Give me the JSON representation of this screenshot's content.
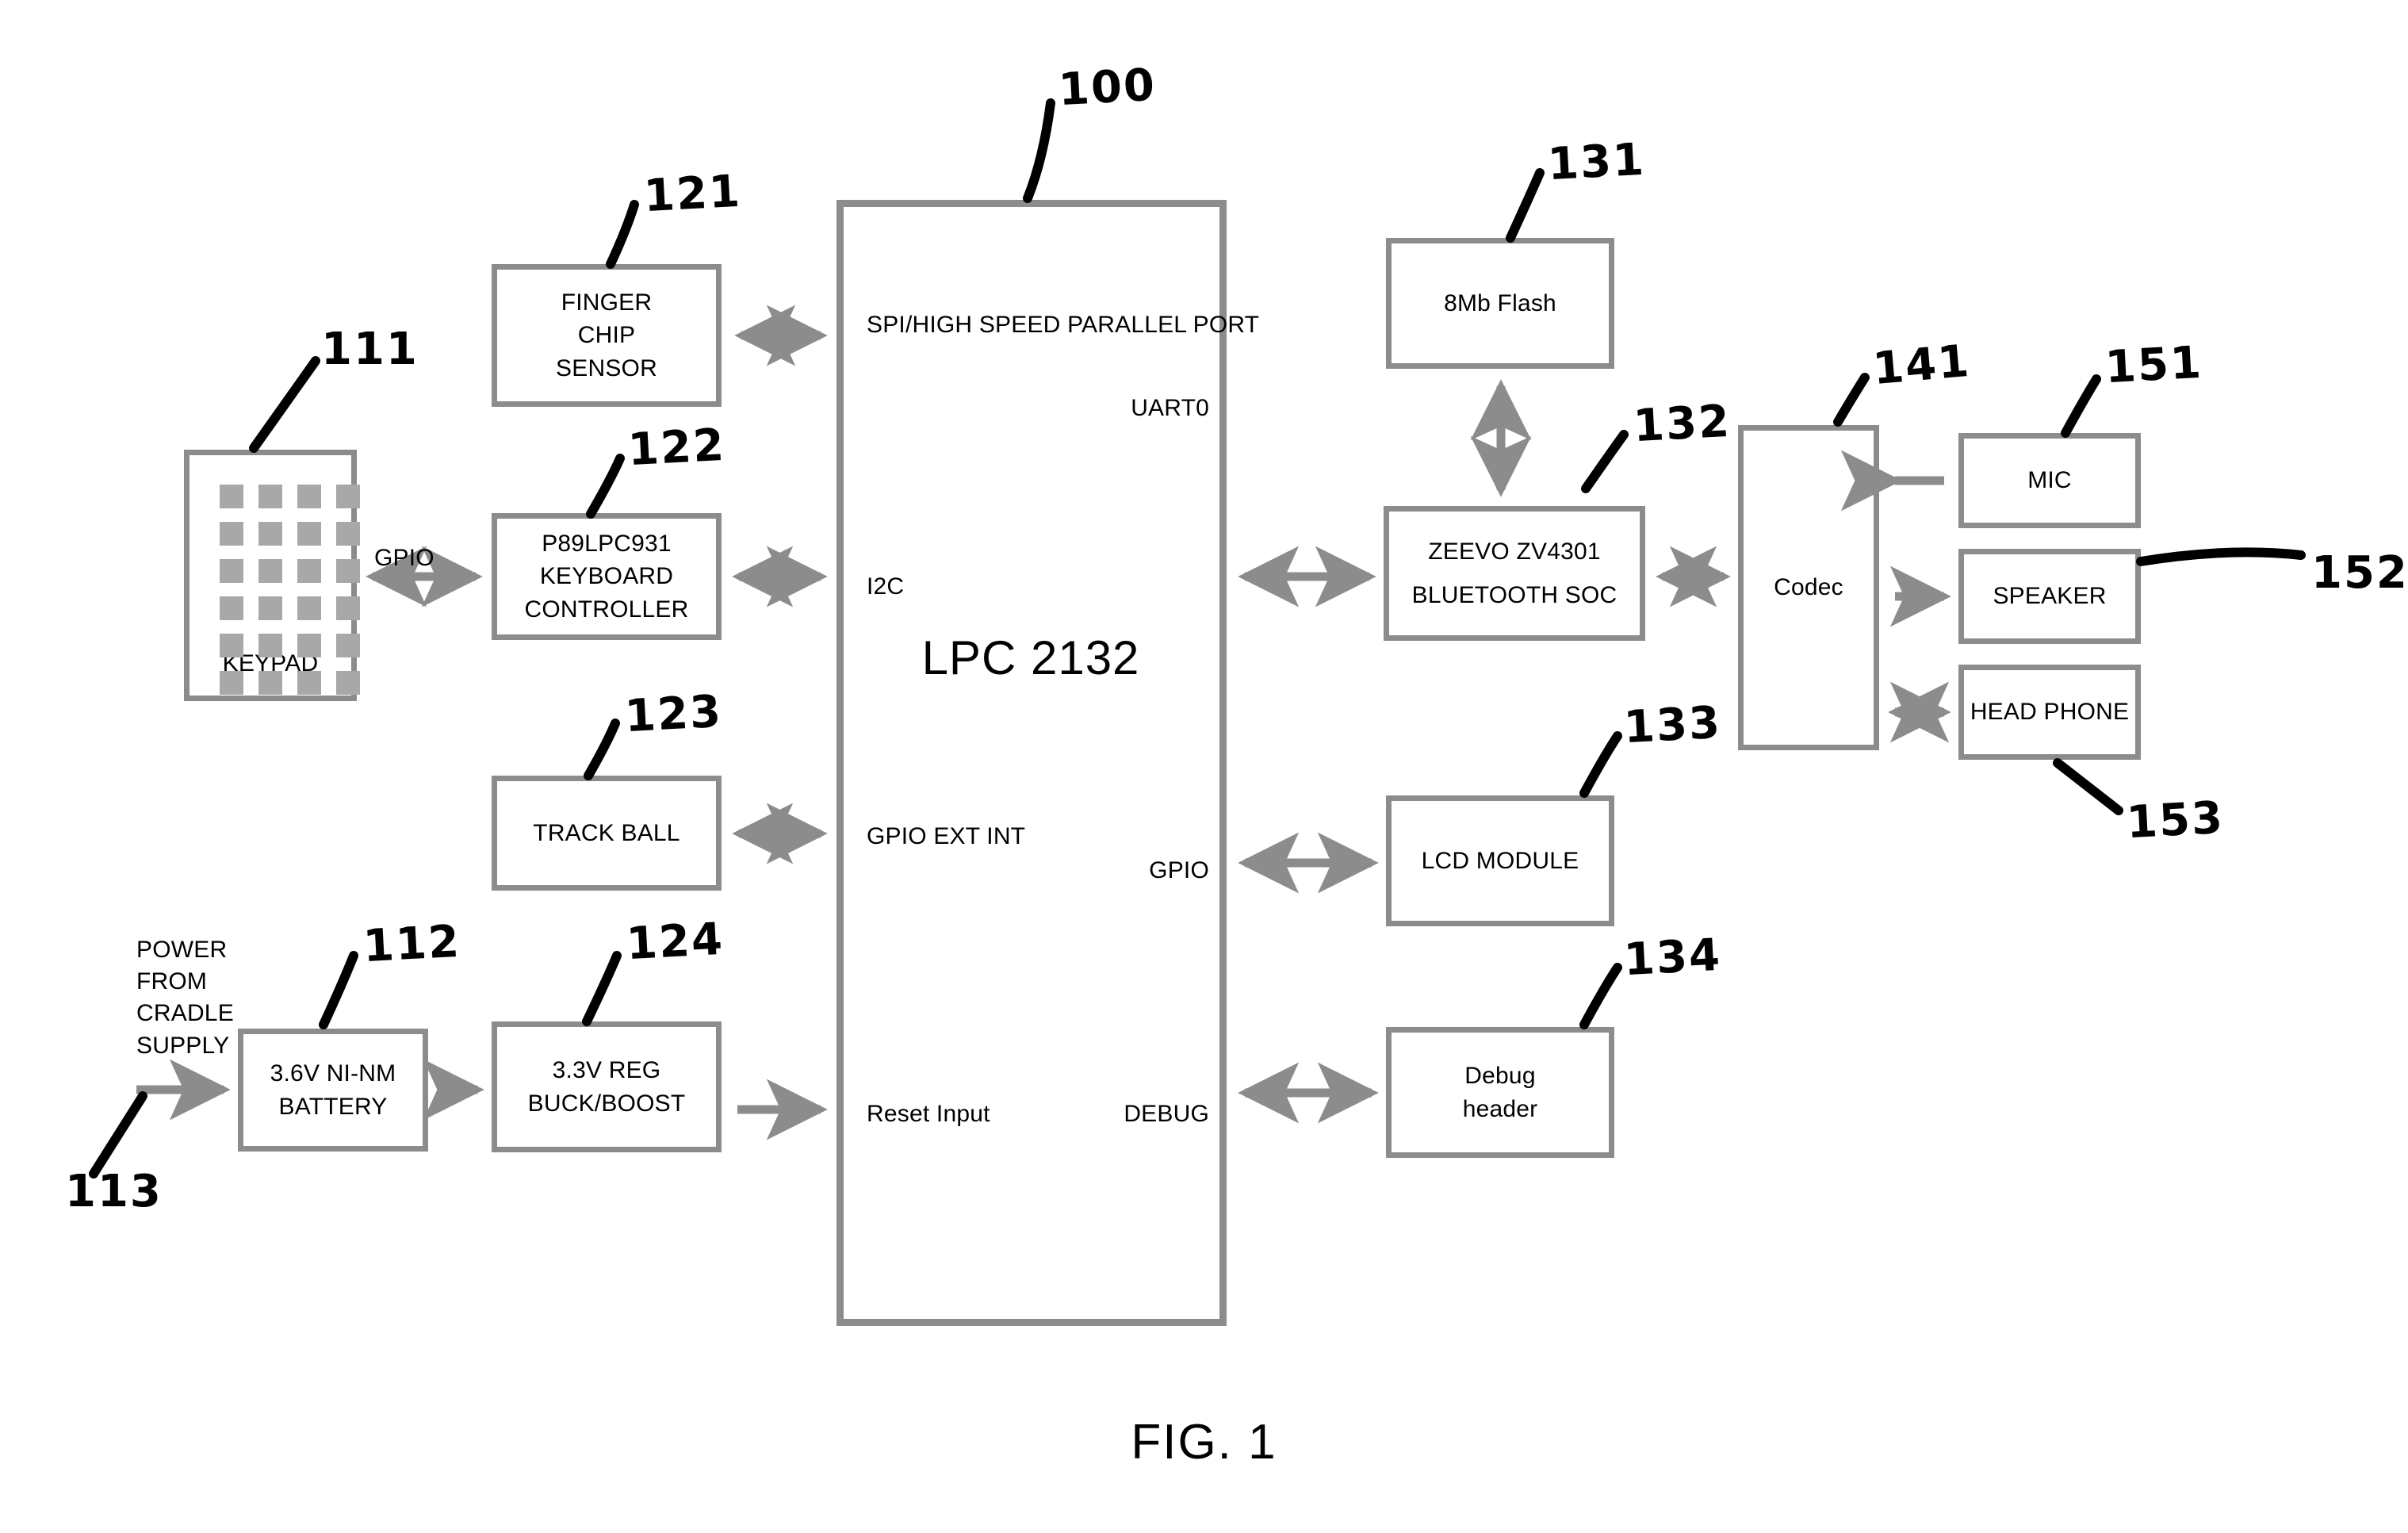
{
  "figure": {
    "caption": "FIG. 1",
    "mcu": {
      "title": "LPC 2132",
      "ref": "100",
      "ports": {
        "spi": "SPI/HIGH SPEED\nPARALLEL PORT",
        "uart0": "UART0",
        "i2c": "I2C",
        "gpio_ext_int": "GPIO\nEXT INT",
        "gpio_lcd": "GPIO",
        "reset": "Reset Input",
        "debug": "DEBUG"
      }
    },
    "blocks": {
      "finger_chip_sensor": {
        "lines": [
          "FINGER",
          "CHIP",
          "SENSOR"
        ],
        "ref": "121"
      },
      "keypad": {
        "lines": [
          "KEYPAD"
        ],
        "ref": "111"
      },
      "keyboard_controller": {
        "lines": [
          "P89LPC931",
          "KEYBOARD",
          "CONTROLLER"
        ],
        "ref": "122"
      },
      "track_ball": {
        "lines": [
          "TRACK BALL"
        ],
        "ref": "123"
      },
      "battery": {
        "lines": [
          "3.6V NI-NM",
          "BATTERY"
        ],
        "ref": "112"
      },
      "regulator": {
        "lines": [
          "3.3V REG",
          "BUCK/BOOST"
        ],
        "ref": "124"
      },
      "flash": {
        "lines": [
          "8Mb Flash"
        ],
        "ref": "131"
      },
      "bluetooth_soc": {
        "lines": [
          "ZEEVO ZV4301",
          "BLUETOOTH SOC"
        ],
        "ref": "132"
      },
      "lcd_module": {
        "lines": [
          "LCD MODULE"
        ],
        "ref": "133"
      },
      "debug_header": {
        "lines": [
          "Debug",
          "header"
        ],
        "ref": "134"
      },
      "codec": {
        "lines": [
          "Codec"
        ],
        "ref": "141"
      },
      "mic": {
        "lines": [
          "MIC"
        ],
        "ref": "151"
      },
      "speaker": {
        "lines": [
          "SPEAKER"
        ],
        "ref": "152"
      },
      "head_phone": {
        "lines": [
          "HEAD PHONE"
        ],
        "ref": "153"
      }
    },
    "connection_labels": {
      "keypad_gpio": "GPIO"
    },
    "annotations": {
      "power_source": "POWER\nFROM\nCRADLE\nSUPPLY",
      "power_source_ref": "113"
    },
    "colors": {
      "ink": "#000000",
      "box_border": "#8c8c8c",
      "key_fill": "#a8a8a8",
      "background": "#ffffff"
    }
  }
}
